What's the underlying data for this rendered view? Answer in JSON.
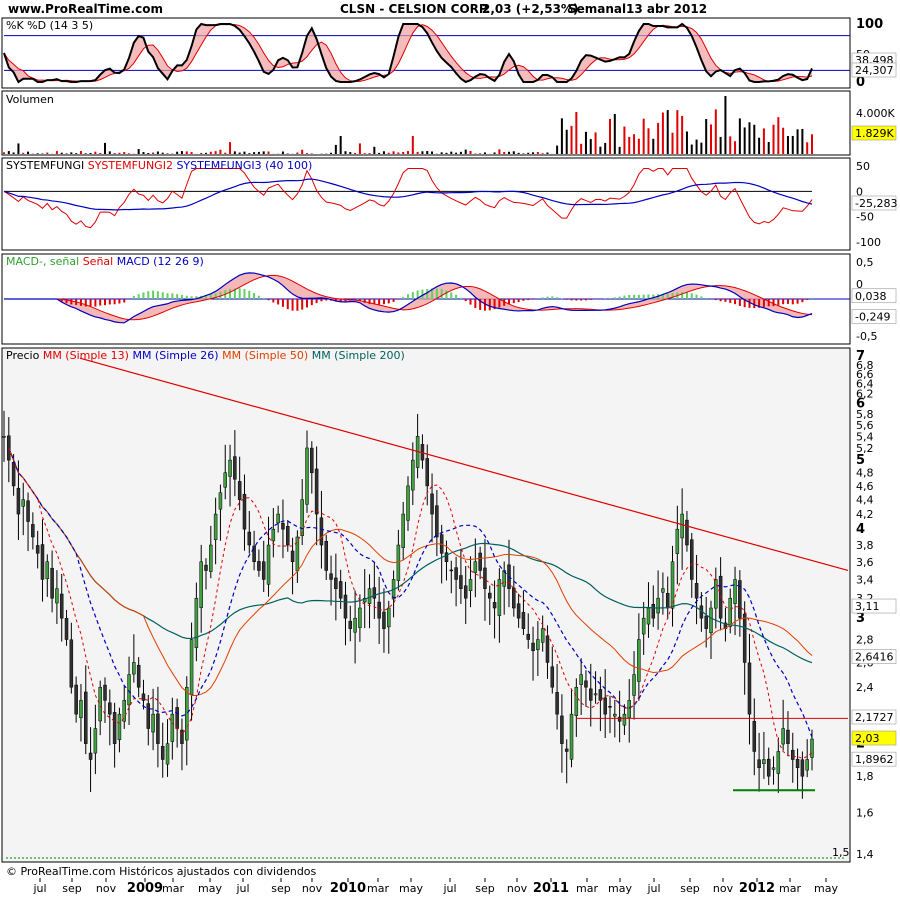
{
  "header": {
    "site": "www.ProRealTime.com",
    "ticker": "CLSN - CELSION CORP.",
    "quote": "2,03 (+2,53%)",
    "period": "Semanal",
    "date": "13 abr 2012"
  },
  "footer": {
    "copyright": "© ProRealTime.com Históricos ajustados con dividendos"
  },
  "colors": {
    "red": "#e00000",
    "blue": "#0000c0",
    "green_ma": "#006060",
    "orange": "#e04000",
    "pink_fill": "#f0a0a0",
    "blue_fill": "#a0a0e0",
    "green_fill": "#60d060",
    "candle_up": "#40a040",
    "candle_down": "#303030",
    "panel_bg": "#f4f4f4",
    "highlight": "#ffff00"
  },
  "panels": {
    "stoch": {
      "label_parts": [
        {
          "text": "%K %D (14 3 5)",
          "color": "#000000"
        }
      ],
      "axis": [
        "100",
        "50",
        "0"
      ],
      "last_values": [
        "38,498",
        "24,307"
      ]
    },
    "volume": {
      "label_parts": [
        {
          "text": "Volumen",
          "color": "#000000"
        }
      ],
      "axis": [
        "4.000K"
      ],
      "last_values": [
        "1.829K"
      ]
    },
    "sysfungi": {
      "label_parts": [
        {
          "text": "SYSTEMFUNGI",
          "color": "#000000"
        },
        {
          "text": "SYSTEMFUNGI2",
          "color": "#e00000"
        },
        {
          "text": "SYSTEMFUNGI3 (40 100)",
          "color": "#0000c0"
        }
      ],
      "axis": [
        "50",
        "0",
        "-50",
        "-100"
      ],
      "last_values": [
        "-25,283"
      ]
    },
    "macd": {
      "label_parts": [
        {
          "text": "MACD-, señal",
          "color": "#30a030"
        },
        {
          "text": "Señal",
          "color": "#e00000"
        },
        {
          "text": "MACD (12 26 9)",
          "color": "#0000c0"
        }
      ],
      "axis": [
        "0,5",
        "0",
        "-0,5"
      ],
      "last_values": [
        "0,038",
        "-0,249"
      ]
    },
    "price": {
      "label_parts": [
        {
          "text": "Precio",
          "color": "#000000"
        },
        {
          "text": "MM (Simple 13)",
          "color": "#e00000"
        },
        {
          "text": "MM (Simple 26)",
          "color": "#0000c0"
        },
        {
          "text": "MM (Simple 50)",
          "color": "#e04000"
        },
        {
          "text": "MM (Simple 200)",
          "color": "#006060"
        }
      ],
      "last_values": [
        "3,11",
        "2,6416",
        "2,1727",
        "2,03",
        "1,8962"
      ],
      "support_label": "1,5"
    }
  },
  "chart_data": {
    "type": "candlestick",
    "title": "CLSN - CELSION CORP. Semanal",
    "x_tick_labels": [
      "jul",
      "sep",
      "nov",
      "2009",
      "mar",
      "may",
      "jul",
      "sep",
      "nov",
      "2010",
      "mar",
      "may",
      "jul",
      "sep",
      "nov",
      "2011",
      "mar",
      "may",
      "jul",
      "sep",
      "nov",
      "2012",
      "mar",
      "may"
    ],
    "price_axis": {
      "scale": "log",
      "ylim": [
        1.4,
        7
      ],
      "ticks": [
        "7",
        "6,8",
        "6,6",
        "6,4",
        "6,2",
        "6",
        "5,8",
        "5,6",
        "5,4",
        "5,2",
        "5",
        "4,8",
        "4,6",
        "4,4",
        "4,2",
        "4",
        "3,8",
        "3,6",
        "3,4",
        "3,2",
        "3",
        "2,8",
        "2,6",
        "2,4",
        "2,2",
        "2",
        "1,8",
        "1,6",
        "1,4"
      ]
    },
    "weekly_close_approx": [
      5.4,
      5.0,
      4.6,
      4.2,
      4.4,
      4.1,
      3.9,
      3.7,
      3.4,
      3.6,
      3.2,
      3.3,
      3.0,
      2.8,
      2.4,
      2.2,
      2.3,
      2.0,
      1.9,
      2.1,
      2.4,
      2.3,
      2.2,
      2.0,
      2.2,
      2.3,
      2.5,
      2.6,
      2.4,
      2.3,
      2.1,
      2.2,
      2.0,
      1.9,
      2.0,
      2.2,
      2.1,
      2.0,
      2.4,
      2.8,
      3.2,
      3.6,
      3.5,
      3.8,
      4.2,
      4.5,
      4.8,
      5.0,
      4.7,
      4.4,
      4.0,
      3.8,
      3.6,
      3.5,
      3.4,
      3.8,
      4.0,
      4.2,
      4.0,
      3.8,
      3.6,
      3.9,
      4.4,
      5.2,
      4.8,
      4.2,
      3.8,
      3.5,
      3.4,
      3.3,
      3.2,
      3.0,
      2.9,
      3.0,
      3.1,
      3.2,
      3.3,
      3.2,
      3.0,
      2.9,
      3.1,
      3.4,
      3.8,
      4.2,
      4.6,
      5.0,
      5.4,
      5.0,
      4.6,
      4.2,
      3.9,
      3.7,
      3.6,
      3.5,
      3.4,
      3.3,
      3.2,
      3.4,
      3.6,
      3.5,
      3.3,
      3.2,
      3.1,
      3.4,
      3.5,
      3.3,
      3.1,
      3.0,
      2.9,
      2.8,
      2.7,
      2.8,
      2.9,
      2.6,
      2.4,
      2.2,
      2.0,
      1.95,
      2.2,
      2.4,
      2.5,
      2.4,
      2.3,
      2.35,
      2.3,
      2.2,
      2.25,
      2.2,
      2.15,
      2.2,
      2.3,
      2.5,
      2.8,
      3.0,
      3.1,
      3.0,
      3.2,
      3.3,
      3.1,
      3.6,
      4.0,
      4.2,
      3.8,
      3.4,
      3.2,
      3.0,
      2.9,
      3.1,
      3.4,
      3.0,
      2.9,
      3.2,
      3.4,
      3.0,
      2.6,
      2.2,
      1.95,
      1.85,
      1.9,
      1.8,
      1.85,
      1.95,
      2.1,
      2.0,
      1.9,
      1.85,
      1.8,
      1.9,
      2.03
    ],
    "indicators": {
      "sma_13_last": 2.1727,
      "sma_26_last": 2.6416,
      "sma_50_last": 3.11,
      "sma_200_last": 1.8962,
      "close_last": 2.03,
      "support": 1.5
    },
    "stochastic": {
      "k_last": 38.498,
      "d_last": 24.307,
      "range": [
        0,
        100
      ]
    },
    "macd": {
      "macd_last": -0.249,
      "signal_hist_last": 0.038,
      "range": [
        -0.5,
        0.5
      ]
    },
    "systemfungi": {
      "last": -25.283,
      "range": [
        -100,
        50
      ]
    },
    "volume": {
      "last": "1.829K",
      "unit": "K"
    }
  }
}
